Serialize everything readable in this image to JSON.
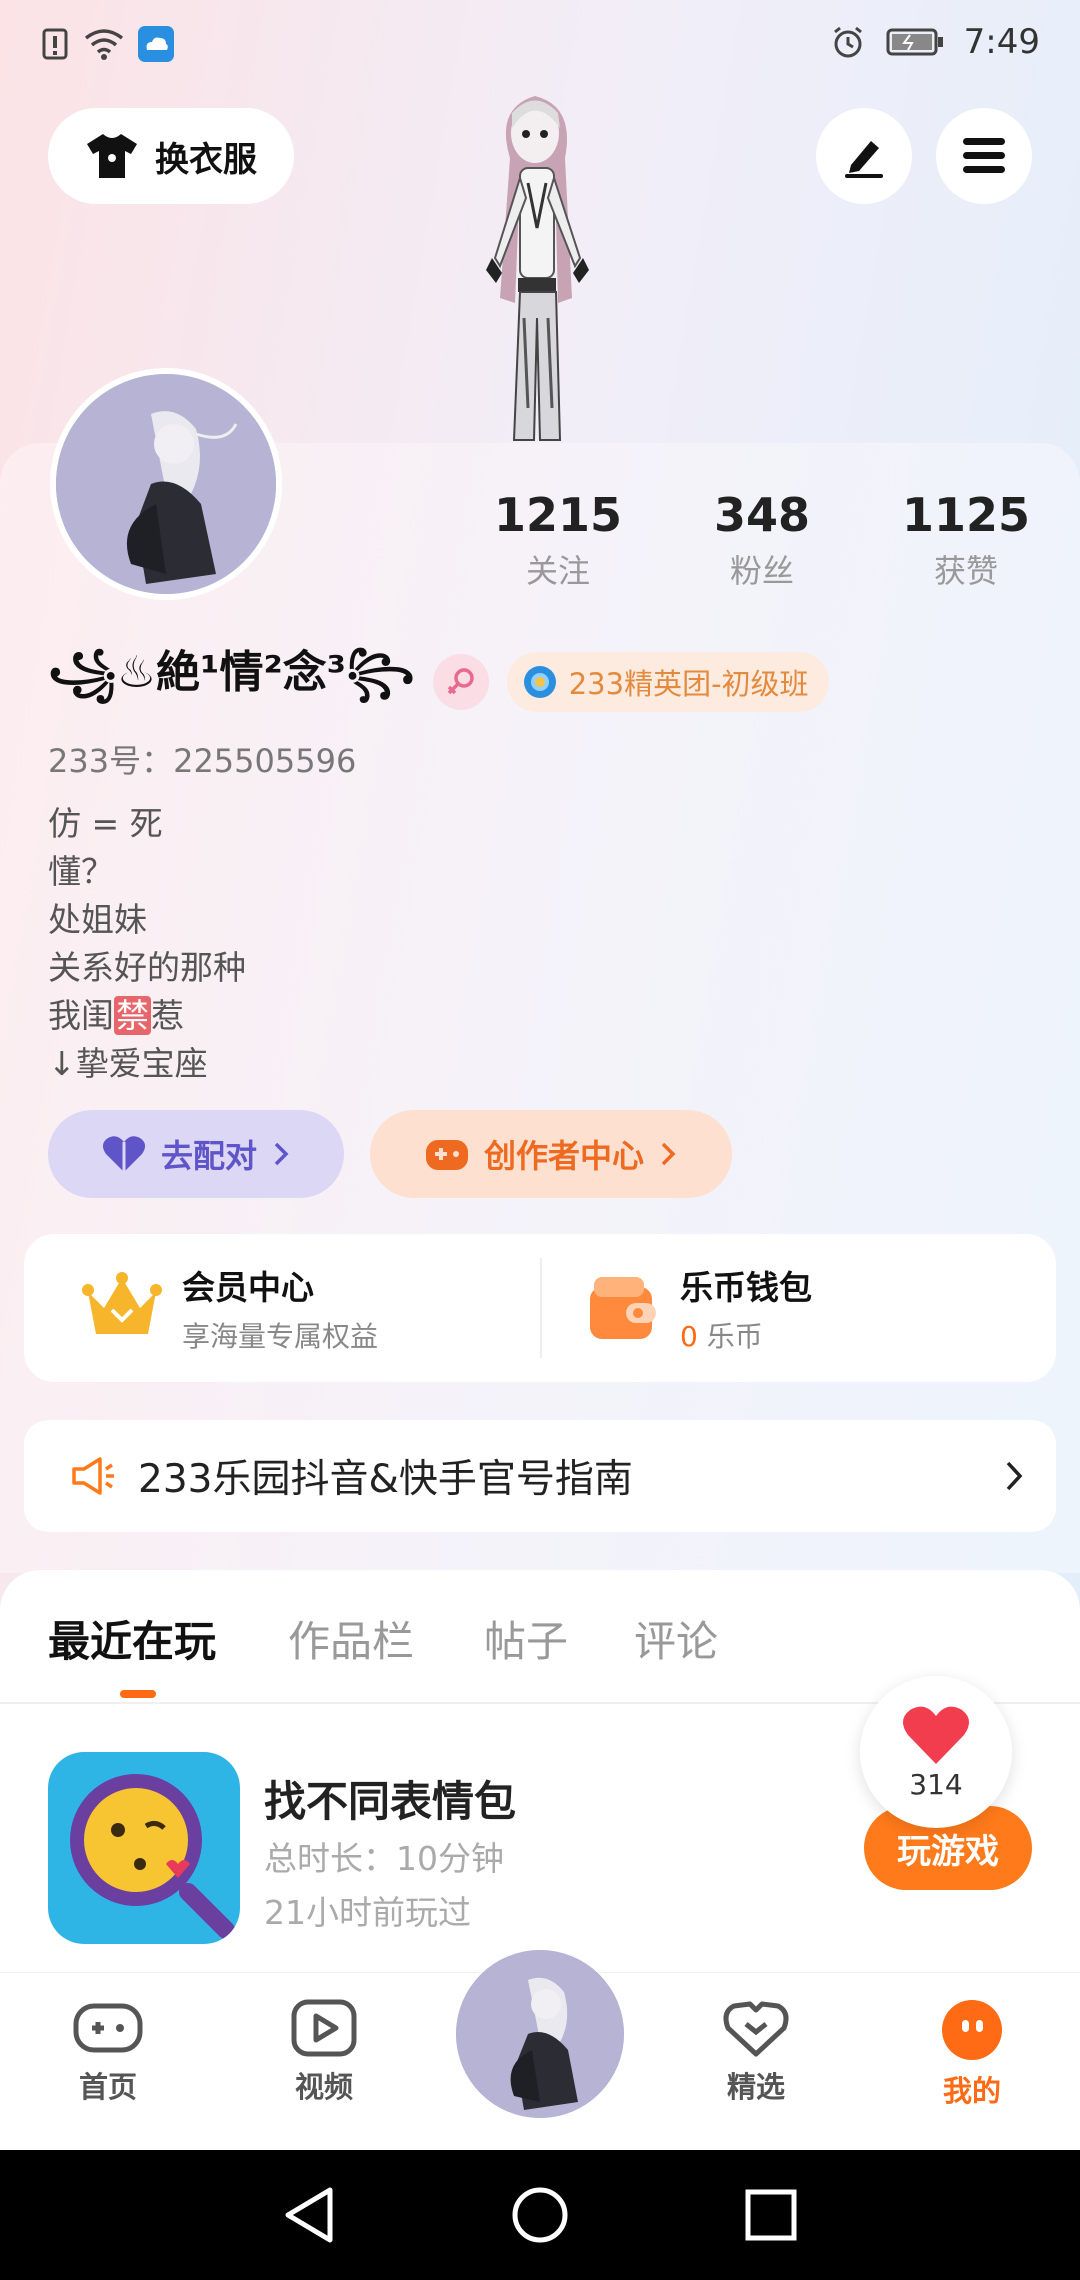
{
  "status_bar": {
    "time": "7:49",
    "icons": [
      "alert-icon",
      "wifi-icon",
      "cloud-app-icon",
      "alarm-icon",
      "battery-icon"
    ]
  },
  "top": {
    "outfit_label": "换衣服",
    "edit_icon": "pen-icon",
    "menu_icon": "menu-icon"
  },
  "stats": [
    {
      "value": "1215",
      "label": "关注"
    },
    {
      "value": "348",
      "label": "粉丝"
    },
    {
      "value": "1125",
      "label": "获赞"
    }
  ],
  "profile": {
    "nickname": "꧁♨絶¹情²念³꧂",
    "club": "233精英团-初级班",
    "uid": "233号：225505596",
    "bio": [
      "仿 = 死",
      "懂？",
      "处姐妹",
      "关系好的那种"
    ],
    "bio_line5_a": "我闺",
    "bio_line5_ban": "禁",
    "bio_line5_b": "惹",
    "bio_line6": "↓挚爱宝座"
  },
  "actions": {
    "pair": "去配对",
    "creator": "创作者中心"
  },
  "member": {
    "title": "会员中心",
    "sub": "享海量专属权益"
  },
  "wallet": {
    "title": "乐币钱包",
    "amount": "0",
    "unit": "乐币"
  },
  "notice": {
    "text": "233乐园抖音&快手官号指南"
  },
  "tabs": [
    "最近在玩",
    "作品栏",
    "帖子",
    "评论"
  ],
  "game": {
    "title": "找不同表情包",
    "duration": "总时长：10分钟",
    "last_played": "21小时前玩过",
    "play_label": "玩游戏",
    "likes": "314"
  },
  "bottom_nav": [
    "首页",
    "视频",
    "精选",
    "我的"
  ],
  "colors": {
    "accent": "#ff6a14",
    "purple": "#5f55c8",
    "orange_bg": "#fde0d0"
  }
}
